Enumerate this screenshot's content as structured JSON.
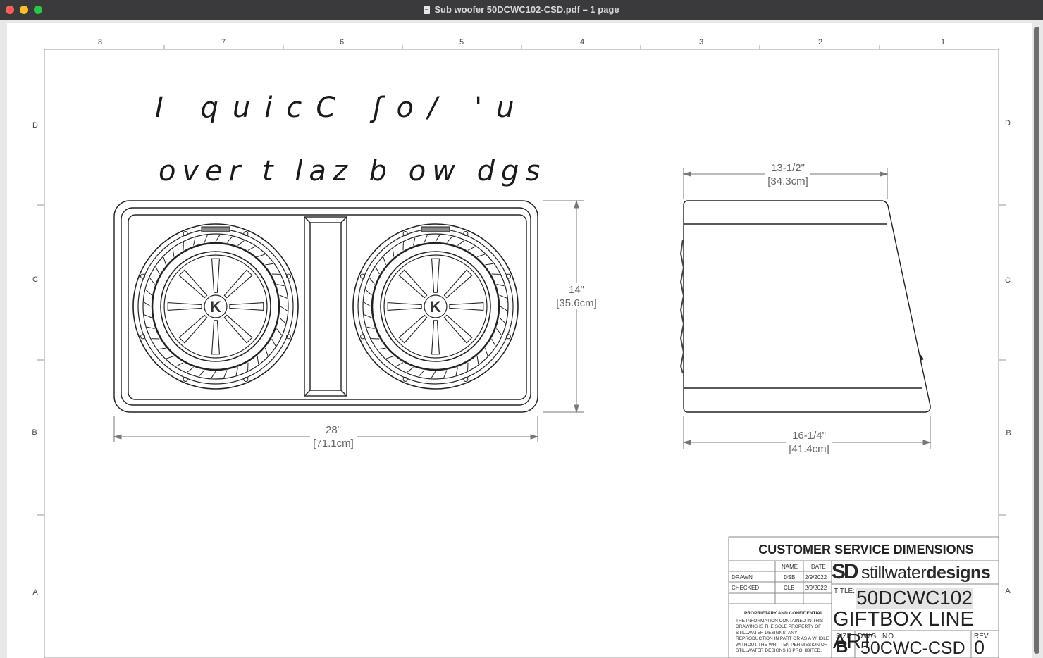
{
  "window": {
    "title": "Sub woofer 50DCWC102-CSD.pdf – 1 page",
    "title_icon": "pdf-document-icon"
  },
  "drawing": {
    "zone_columns": [
      "8",
      "7",
      "6",
      "5",
      "4",
      "3",
      "2",
      "1"
    ],
    "zone_rows": [
      "D",
      "C",
      "B",
      "A"
    ],
    "handwriting": {
      "line1": "I quicC ʃo/ 'u",
      "line2": "over t laz b ow dgs"
    },
    "dimensions": {
      "front_width": {
        "imperial": "28\"",
        "metric": "[71.1cm]"
      },
      "front_height": {
        "imperial": "14\"",
        "metric": "[35.6cm]"
      },
      "side_top_depth": {
        "imperial": "13-1/2\"",
        "metric": "[34.3cm]"
      },
      "side_bottom_depth": {
        "imperial": "16-1/4\"",
        "metric": "[41.4cm]"
      }
    },
    "woofer_logo_text": "K"
  },
  "title_block": {
    "heading": "CUSTOMER SERVICE DIMENSIONS",
    "col_name": "NAME",
    "col_date": "DATE",
    "rows": [
      {
        "label": "DRAWN",
        "name": "DSB",
        "date": "2/9/2022"
      },
      {
        "label": "CHECKED",
        "name": "CLB",
        "date": "2/9/2022"
      }
    ],
    "confidential_heading": "PROPRIETARY AND CONFIDENTIAL",
    "confidential_text": "THE INFORMATION CONTAINED IN THIS DRAWING IS THE SOLE PROPERTY OF STILLWATER DESIGNS. ANY REPRODUCTION IN PART OR AS A WHOLE WITHOUT THE WRITTEN PERMISSION OF STILLWATER DESIGNS IS PROHIBITED.",
    "logo_mark": "SD",
    "logo_text_light": "stillwater",
    "logo_text_bold": "designs",
    "title_label": "TITLE:",
    "title_line1": "50DCWC102",
    "title_line2": "GIFTBOX LINE ART",
    "size_label": "SIZE",
    "size_value": "B",
    "dwg_label": "DWG. NO.",
    "dwg_value": "50CWC-CSD",
    "rev_label": "REV",
    "rev_value": "0"
  }
}
